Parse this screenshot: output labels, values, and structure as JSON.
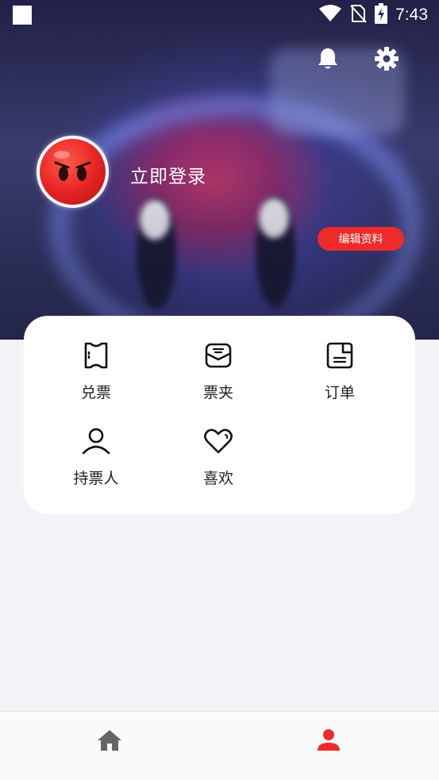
{
  "status_bar": {
    "time": "7:43",
    "icons": [
      "wifi-icon",
      "no-sim-icon",
      "battery-charging-icon"
    ]
  },
  "header": {
    "actions": [
      "bell-icon",
      "gear-icon"
    ]
  },
  "profile": {
    "login_label": "立即登录",
    "edit_label": "编辑资料"
  },
  "menu": {
    "items": [
      {
        "label": "兑票",
        "icon": "ticket-icon"
      },
      {
        "label": "票夹",
        "icon": "ticket-folder-icon"
      },
      {
        "label": "订单",
        "icon": "order-icon"
      },
      {
        "label": "持票人",
        "icon": "person-icon"
      },
      {
        "label": "喜欢",
        "icon": "heart-icon"
      }
    ]
  },
  "tab_bar": {
    "tabs": [
      {
        "icon": "home-icon",
        "active": false
      },
      {
        "icon": "profile-icon",
        "active": true
      }
    ]
  },
  "colors": {
    "accent": "#ef2a2a",
    "page_background": "#f3f3f7",
    "tab_inactive": "#666666"
  }
}
